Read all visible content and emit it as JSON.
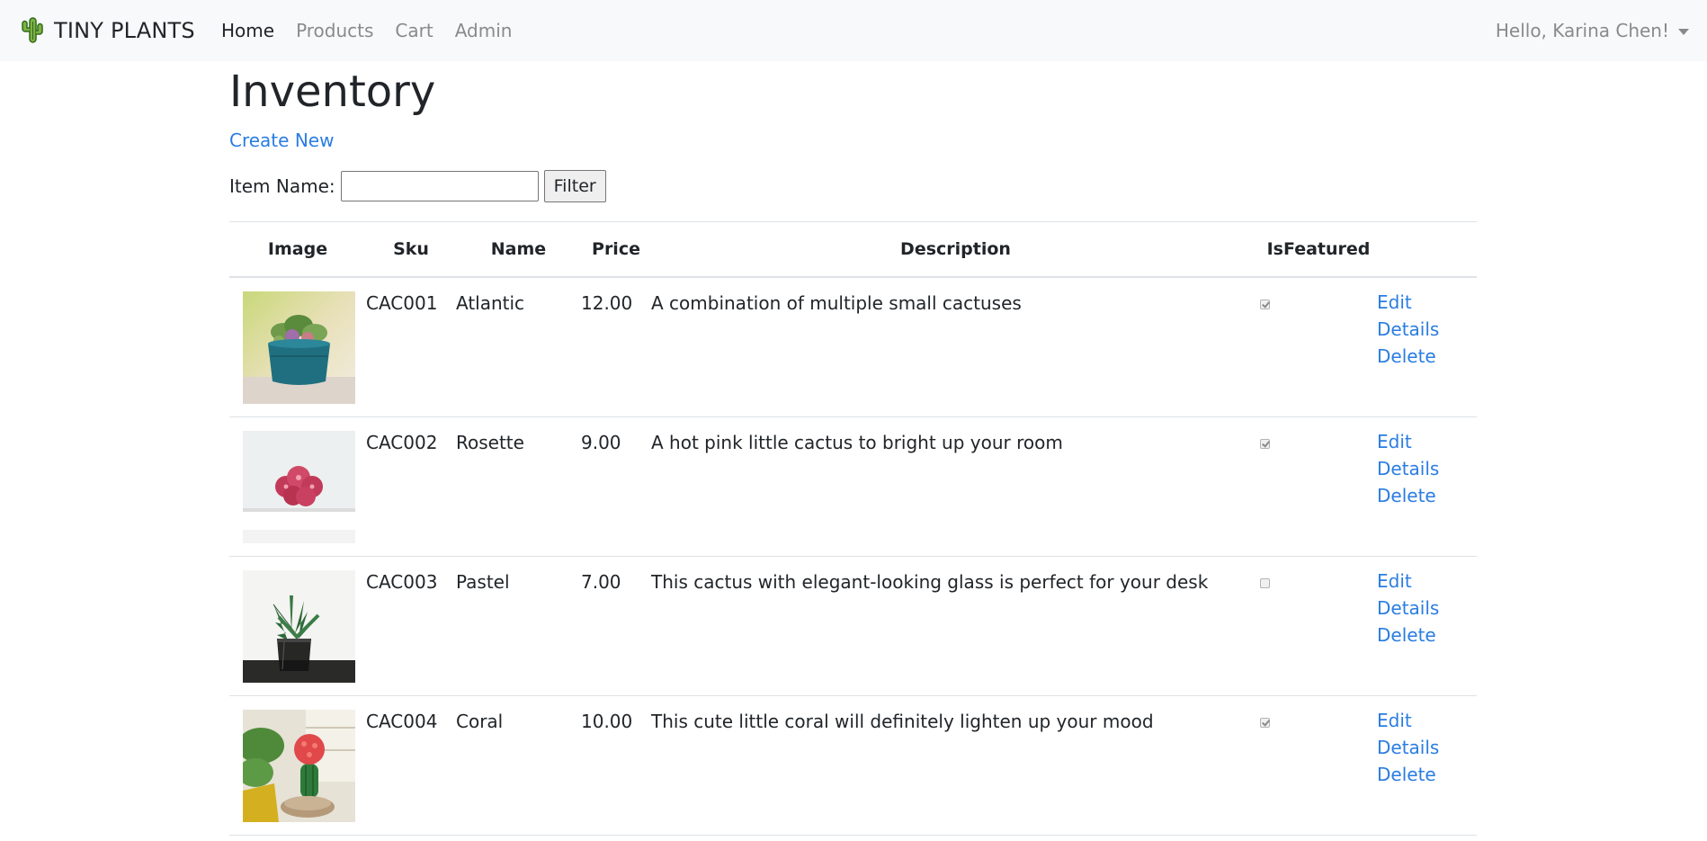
{
  "navbar": {
    "brand": "TINY PLANTS",
    "links": [
      {
        "label": "Home",
        "active": true
      },
      {
        "label": "Products",
        "active": false
      },
      {
        "label": "Cart",
        "active": false
      },
      {
        "label": "Admin",
        "active": false
      }
    ],
    "user_greeting": "Hello, Karina Chen!"
  },
  "page": {
    "title": "Inventory",
    "create_link": "Create New"
  },
  "filter": {
    "label": "Item Name:",
    "value": "",
    "button": "Filter"
  },
  "table": {
    "headers": [
      "Image",
      "Sku",
      "Name",
      "Price",
      "Description",
      "IsFeatured"
    ],
    "rows": [
      {
        "sku": "CAC001",
        "name": "Atlantic",
        "price": "12.00",
        "description": "A combination of multiple small cactuses",
        "featured": true,
        "image_icon": "succulent-pot-teal"
      },
      {
        "sku": "CAC002",
        "name": "Rosette",
        "price": "9.00",
        "description": "A hot pink little cactus to bright up your room",
        "featured": true,
        "image_icon": "pink-cactus-white-pot"
      },
      {
        "sku": "CAC003",
        "name": "Pastel",
        "price": "7.00",
        "description": "This cactus with elegant-looking glass is perfect for your desk",
        "featured": false,
        "image_icon": "cactus-glass-pot"
      },
      {
        "sku": "CAC004",
        "name": "Coral",
        "price": "10.00",
        "description": "This cute little coral will definitely lighten up your mood",
        "featured": true,
        "image_icon": "red-moon-cactus"
      }
    ],
    "row_actions": {
      "edit": "Edit",
      "details": "Details",
      "delete": "Delete"
    }
  },
  "colors": {
    "navbar_bg": "#f8f9fa",
    "link": "#2a7de1",
    "muted_nav": "#8a8a8a"
  }
}
